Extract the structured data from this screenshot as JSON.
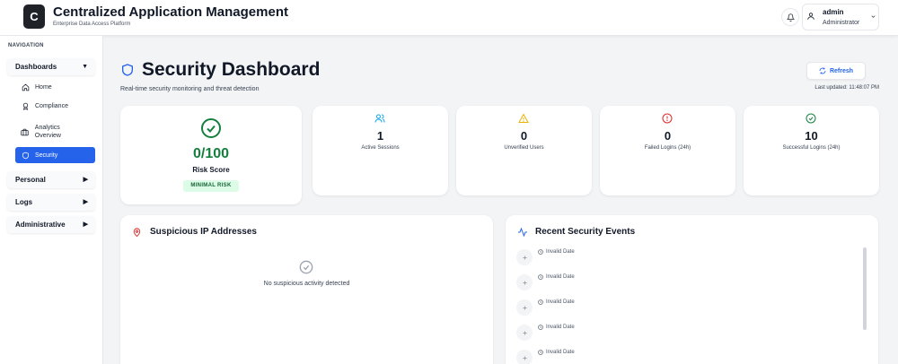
{
  "header": {
    "logo_letter": "C",
    "title": "Centralized Application Management",
    "subtitle": "Enterprise Data Access Platform",
    "user_name": "admin",
    "user_role": "Administrator"
  },
  "sidebar": {
    "nav_label": "NAVIGATION",
    "groups": [
      {
        "label": "Dashboards",
        "arrow": "▼"
      },
      {
        "label": "Personal",
        "arrow": "▶"
      },
      {
        "label": "Logs",
        "arrow": "▶"
      },
      {
        "label": "Administrative",
        "arrow": "▶"
      }
    ],
    "items": [
      {
        "label": "Home",
        "icon": "home-icon"
      },
      {
        "label": "Compliance",
        "icon": "award-icon"
      },
      {
        "label": "Analytics Overview",
        "icon": "briefcase-icon"
      },
      {
        "label": "Security",
        "icon": "shield-icon"
      }
    ]
  },
  "page": {
    "title": "Security Dashboard",
    "subtitle": "Real-time security monitoring and threat detection",
    "refresh_label": "Refresh",
    "last_updated": "Last updated: 11:48:07 PM"
  },
  "risk": {
    "value": "0/100",
    "label": "Risk Score",
    "badge": "MINIMAL RISK",
    "color": "#15803d"
  },
  "stats": [
    {
      "value": "1",
      "label": "Active Sessions",
      "icon": "users-icon",
      "color": "#0ea5e9"
    },
    {
      "value": "0",
      "label": "Unverified Users",
      "icon": "warning-icon",
      "color": "#eab308"
    },
    {
      "value": "0",
      "label": "Failed Logins (24h)",
      "icon": "alert-circle-icon",
      "color": "#dc2626"
    },
    {
      "value": "10",
      "label": "Successful Logins (24h)",
      "icon": "check-circle-icon",
      "color": "#15803d"
    }
  ],
  "suspicious_panel": {
    "title": "Suspicious IP Addresses",
    "empty_text": "No suspicious activity detected"
  },
  "events_panel": {
    "title": "Recent Security Events",
    "events": [
      {
        "time": "Invalid Date"
      },
      {
        "time": "Invalid Date"
      },
      {
        "time": "Invalid Date"
      },
      {
        "time": "Invalid Date"
      },
      {
        "time": "Invalid Date"
      }
    ]
  },
  "colors": {
    "accent": "#2563eb",
    "success": "#15803d",
    "danger": "#dc2626",
    "warning": "#eab308",
    "info": "#0ea5e9"
  }
}
